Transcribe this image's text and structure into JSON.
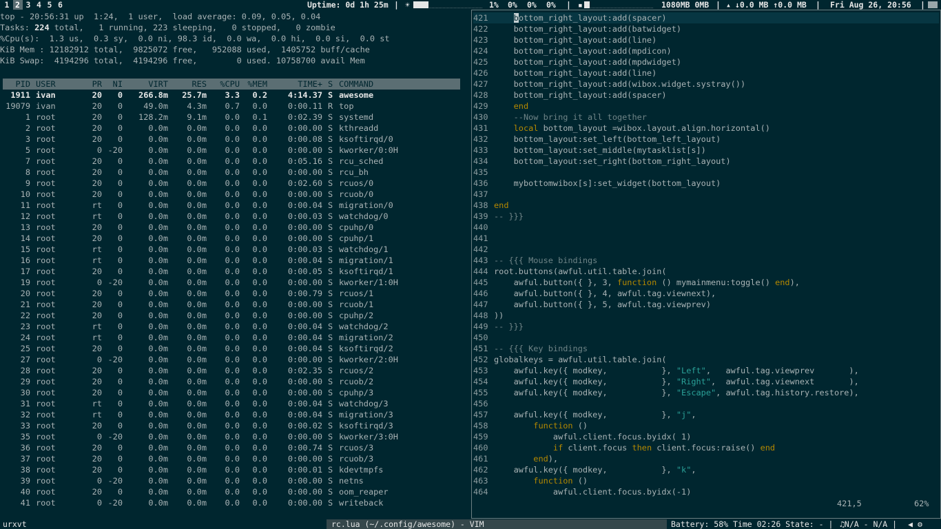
{
  "topbar": {
    "tags": [
      "1",
      "2",
      "3",
      "4",
      "5",
      "6"
    ],
    "selected_tag": "2",
    "uptime": "Uptime: 0d 1h 25m",
    "cpu1": "1%",
    "cpu2": "0%",
    "cpu3": "0%",
    "cpu4": "0%",
    "memory": "1080MB 0MB",
    "net": "↓0.0 MB ↑0.0 MB",
    "date": "Fri Aug 26, 20:56",
    "sep": "|"
  },
  "top": {
    "line1": "top - 20:56:31 up  1:24,  1 user,  load average: 0.09, 0.05, 0.04",
    "tasks_label": "Tasks:",
    "tasks_total": "224",
    "tasks_rest": " total,   1 running, 223 sleeping,   0 stopped,   0 zombie",
    "cpu_line": "%Cpu(s):  1.3 us,  0.3 sy,  0.0 ni, 98.3 id,  0.0 wa,  0.0 hi,  0.0 si,  0.0 st",
    "mem_line": "KiB Mem : 12182912 total,  9825072 free,   952088 used,  1405752 buff/cache",
    "swap_line": "KiB Swap:  4194296 total,  4194296 free,        0 used. 10758700 avail Mem",
    "columns": [
      "PID",
      "USER",
      "PR",
      "NI",
      "VIRT",
      "RES",
      "%CPU",
      "%MEM",
      "TIME+",
      "S",
      "COMMAND"
    ],
    "processes": [
      [
        "1911",
        "ivan",
        "20",
        "0",
        "266.8m",
        "25.7m",
        "3.3",
        "0.2",
        "4:14.37",
        "S",
        "awesome"
      ],
      [
        "19079",
        "ivan",
        "20",
        "0",
        "49.0m",
        "4.3m",
        "0.7",
        "0.0",
        "0:00.11",
        "R",
        "top"
      ],
      [
        "1",
        "root",
        "20",
        "0",
        "128.2m",
        "9.1m",
        "0.0",
        "0.1",
        "0:02.39",
        "S",
        "systemd"
      ],
      [
        "2",
        "root",
        "20",
        "0",
        "0.0m",
        "0.0m",
        "0.0",
        "0.0",
        "0:00.00",
        "S",
        "kthreadd"
      ],
      [
        "3",
        "root",
        "20",
        "0",
        "0.0m",
        "0.0m",
        "0.0",
        "0.0",
        "0:00.08",
        "S",
        "ksoftirqd/0"
      ],
      [
        "5",
        "root",
        "0",
        "-20",
        "0.0m",
        "0.0m",
        "0.0",
        "0.0",
        "0:00.00",
        "S",
        "kworker/0:0H"
      ],
      [
        "7",
        "root",
        "20",
        "0",
        "0.0m",
        "0.0m",
        "0.0",
        "0.0",
        "0:05.16",
        "S",
        "rcu_sched"
      ],
      [
        "8",
        "root",
        "20",
        "0",
        "0.0m",
        "0.0m",
        "0.0",
        "0.0",
        "0:00.00",
        "S",
        "rcu_bh"
      ],
      [
        "9",
        "root",
        "20",
        "0",
        "0.0m",
        "0.0m",
        "0.0",
        "0.0",
        "0:02.60",
        "S",
        "rcuos/0"
      ],
      [
        "10",
        "root",
        "20",
        "0",
        "0.0m",
        "0.0m",
        "0.0",
        "0.0",
        "0:00.00",
        "S",
        "rcuob/0"
      ],
      [
        "11",
        "root",
        "rt",
        "0",
        "0.0m",
        "0.0m",
        "0.0",
        "0.0",
        "0:00.04",
        "S",
        "migration/0"
      ],
      [
        "12",
        "root",
        "rt",
        "0",
        "0.0m",
        "0.0m",
        "0.0",
        "0.0",
        "0:00.03",
        "S",
        "watchdog/0"
      ],
      [
        "13",
        "root",
        "20",
        "0",
        "0.0m",
        "0.0m",
        "0.0",
        "0.0",
        "0:00.00",
        "S",
        "cpuhp/0"
      ],
      [
        "14",
        "root",
        "20",
        "0",
        "0.0m",
        "0.0m",
        "0.0",
        "0.0",
        "0:00.00",
        "S",
        "cpuhp/1"
      ],
      [
        "15",
        "root",
        "rt",
        "0",
        "0.0m",
        "0.0m",
        "0.0",
        "0.0",
        "0:00.03",
        "S",
        "watchdog/1"
      ],
      [
        "16",
        "root",
        "rt",
        "0",
        "0.0m",
        "0.0m",
        "0.0",
        "0.0",
        "0:00.04",
        "S",
        "migration/1"
      ],
      [
        "17",
        "root",
        "20",
        "0",
        "0.0m",
        "0.0m",
        "0.0",
        "0.0",
        "0:00.05",
        "S",
        "ksoftirqd/1"
      ],
      [
        "19",
        "root",
        "0",
        "-20",
        "0.0m",
        "0.0m",
        "0.0",
        "0.0",
        "0:00.00",
        "S",
        "kworker/1:0H"
      ],
      [
        "20",
        "root",
        "20",
        "0",
        "0.0m",
        "0.0m",
        "0.0",
        "0.0",
        "0:00.79",
        "S",
        "rcuos/1"
      ],
      [
        "21",
        "root",
        "20",
        "0",
        "0.0m",
        "0.0m",
        "0.0",
        "0.0",
        "0:00.00",
        "S",
        "rcuob/1"
      ],
      [
        "22",
        "root",
        "20",
        "0",
        "0.0m",
        "0.0m",
        "0.0",
        "0.0",
        "0:00.00",
        "S",
        "cpuhp/2"
      ],
      [
        "23",
        "root",
        "rt",
        "0",
        "0.0m",
        "0.0m",
        "0.0",
        "0.0",
        "0:00.04",
        "S",
        "watchdog/2"
      ],
      [
        "24",
        "root",
        "rt",
        "0",
        "0.0m",
        "0.0m",
        "0.0",
        "0.0",
        "0:00.04",
        "S",
        "migration/2"
      ],
      [
        "25",
        "root",
        "20",
        "0",
        "0.0m",
        "0.0m",
        "0.0",
        "0.0",
        "0:00.04",
        "S",
        "ksoftirqd/2"
      ],
      [
        "27",
        "root",
        "0",
        "-20",
        "0.0m",
        "0.0m",
        "0.0",
        "0.0",
        "0:00.00",
        "S",
        "kworker/2:0H"
      ],
      [
        "28",
        "root",
        "20",
        "0",
        "0.0m",
        "0.0m",
        "0.0",
        "0.0",
        "0:02.35",
        "S",
        "rcuos/2"
      ],
      [
        "29",
        "root",
        "20",
        "0",
        "0.0m",
        "0.0m",
        "0.0",
        "0.0",
        "0:00.00",
        "S",
        "rcuob/2"
      ],
      [
        "30",
        "root",
        "20",
        "0",
        "0.0m",
        "0.0m",
        "0.0",
        "0.0",
        "0:00.00",
        "S",
        "cpuhp/3"
      ],
      [
        "31",
        "root",
        "rt",
        "0",
        "0.0m",
        "0.0m",
        "0.0",
        "0.0",
        "0:00.04",
        "S",
        "watchdog/3"
      ],
      [
        "32",
        "root",
        "rt",
        "0",
        "0.0m",
        "0.0m",
        "0.0",
        "0.0",
        "0:00.04",
        "S",
        "migration/3"
      ],
      [
        "33",
        "root",
        "20",
        "0",
        "0.0m",
        "0.0m",
        "0.0",
        "0.0",
        "0:00.02",
        "S",
        "ksoftirqd/3"
      ],
      [
        "35",
        "root",
        "0",
        "-20",
        "0.0m",
        "0.0m",
        "0.0",
        "0.0",
        "0:00.00",
        "S",
        "kworker/3:0H"
      ],
      [
        "36",
        "root",
        "20",
        "0",
        "0.0m",
        "0.0m",
        "0.0",
        "0.0",
        "0:00.74",
        "S",
        "rcuos/3"
      ],
      [
        "37",
        "root",
        "20",
        "0",
        "0.0m",
        "0.0m",
        "0.0",
        "0.0",
        "0:00.00",
        "S",
        "rcuob/3"
      ],
      [
        "38",
        "root",
        "20",
        "0",
        "0.0m",
        "0.0m",
        "0.0",
        "0.0",
        "0:00.01",
        "S",
        "kdevtmpfs"
      ],
      [
        "39",
        "root",
        "0",
        "-20",
        "0.0m",
        "0.0m",
        "0.0",
        "0.0",
        "0:00.00",
        "S",
        "netns"
      ],
      [
        "40",
        "root",
        "20",
        "0",
        "0.0m",
        "0.0m",
        "0.0",
        "0.0",
        "0:00.00",
        "S",
        "oom_reaper"
      ],
      [
        "41",
        "root",
        "0",
        "-20",
        "0.0m",
        "0.0m",
        "0.0",
        "0.0",
        "0:00.00",
        "S",
        "writeback"
      ]
    ]
  },
  "vim": {
    "lines": [
      {
        "n": "421",
        "t": [
          [
            "p",
            "    "
          ],
          [
            "c",
            "b"
          ],
          [
            "p",
            "ottom_right_layout:add(spacer)"
          ]
        ]
      },
      {
        "n": "422",
        "t": [
          [
            "p",
            "    bottom_right_layout:add(batwidget)"
          ]
        ]
      },
      {
        "n": "423",
        "t": [
          [
            "p",
            "    bottom_right_layout:add(line)"
          ]
        ]
      },
      {
        "n": "424",
        "t": [
          [
            "p",
            "    bottom_right_layout:add(mpdicon)"
          ]
        ]
      },
      {
        "n": "425",
        "t": [
          [
            "p",
            "    bottom_right_layout:add(mpdwidget)"
          ]
        ]
      },
      {
        "n": "426",
        "t": [
          [
            "p",
            "    bottom_right_layout:add(line)"
          ]
        ]
      },
      {
        "n": "427",
        "t": [
          [
            "p",
            "    bottom_right_layout:add(wibox.widget.systray())"
          ]
        ]
      },
      {
        "n": "428",
        "t": [
          [
            "p",
            "    bottom_right_layout:add(spacer)"
          ]
        ]
      },
      {
        "n": "429",
        "t": [
          [
            "p",
            "    "
          ],
          [
            "k",
            "end"
          ]
        ]
      },
      {
        "n": "430",
        "t": [
          [
            "p",
            "    "
          ],
          [
            "m",
            "--Now bring it all together"
          ]
        ]
      },
      {
        "n": "431",
        "t": [
          [
            "p",
            "    "
          ],
          [
            "k",
            "local"
          ],
          [
            "p",
            " bottom_layout =wibox.layout.align.horizontal()"
          ]
        ]
      },
      {
        "n": "432",
        "t": [
          [
            "p",
            "    bottom_layout:set_left(bottom_left_layout)"
          ]
        ]
      },
      {
        "n": "433",
        "t": [
          [
            "p",
            "    bottom_layout:set_middle(mytasklist[s])"
          ]
        ]
      },
      {
        "n": "434",
        "t": [
          [
            "p",
            "    bottom_layout:set_right(bottom_right_layout)"
          ]
        ]
      },
      {
        "n": "435",
        "t": []
      },
      {
        "n": "436",
        "t": [
          [
            "p",
            "    mybottomwibox[s]:set_widget(bottom_layout)"
          ]
        ]
      },
      {
        "n": "437",
        "t": []
      },
      {
        "n": "438",
        "t": [
          [
            "k",
            "end"
          ]
        ]
      },
      {
        "n": "439",
        "t": [
          [
            "m",
            "-- }}}"
          ]
        ]
      },
      {
        "n": "440",
        "t": []
      },
      {
        "n": "441",
        "t": []
      },
      {
        "n": "442",
        "t": []
      },
      {
        "n": "443",
        "t": [
          [
            "m",
            "-- {{{ Mouse bindings"
          ]
        ]
      },
      {
        "n": "444",
        "t": [
          [
            "p",
            "root.buttons(awful.util.table.join("
          ]
        ]
      },
      {
        "n": "445",
        "t": [
          [
            "p",
            "    awful.button({ }, 3, "
          ],
          [
            "k",
            "function"
          ],
          [
            "p",
            " () mymainmenu:toggle() "
          ],
          [
            "k",
            "end"
          ],
          [
            "p",
            "),"
          ]
        ]
      },
      {
        "n": "446",
        "t": [
          [
            "p",
            "    awful.button({ }, 4, awful.tag.viewnext),"
          ]
        ]
      },
      {
        "n": "447",
        "t": [
          [
            "p",
            "    awful.button({ }, 5, awful.tag.viewprev)"
          ]
        ]
      },
      {
        "n": "448",
        "t": [
          [
            "p",
            "))"
          ]
        ]
      },
      {
        "n": "449",
        "t": [
          [
            "m",
            "-- }}}"
          ]
        ]
      },
      {
        "n": "450",
        "t": []
      },
      {
        "n": "451",
        "t": [
          [
            "m",
            "-- {{{ Key bindings"
          ]
        ]
      },
      {
        "n": "452",
        "t": [
          [
            "p",
            "globalkeys = awful.util.table.join("
          ]
        ]
      },
      {
        "n": "453",
        "t": [
          [
            "p",
            "    awful.key({ modkey,           }, "
          ],
          [
            "s",
            "\"Left\""
          ],
          [
            "p",
            ",   awful.tag.viewprev       ),"
          ]
        ]
      },
      {
        "n": "454",
        "t": [
          [
            "p",
            "    awful.key({ modkey,           }, "
          ],
          [
            "s",
            "\"Right\""
          ],
          [
            "p",
            ",  awful.tag.viewnext       ),"
          ]
        ]
      },
      {
        "n": "455",
        "t": [
          [
            "p",
            "    awful.key({ modkey,           }, "
          ],
          [
            "s",
            "\"Escape\""
          ],
          [
            "p",
            ", awful.tag.history.restore),"
          ]
        ]
      },
      {
        "n": "456",
        "t": []
      },
      {
        "n": "457",
        "t": [
          [
            "p",
            "    awful.key({ modkey,           }, "
          ],
          [
            "s",
            "\"j\""
          ],
          [
            "p",
            ","
          ]
        ]
      },
      {
        "n": "458",
        "t": [
          [
            "p",
            "        "
          ],
          [
            "k",
            "function"
          ],
          [
            "p",
            " ()"
          ]
        ]
      },
      {
        "n": "459",
        "t": [
          [
            "p",
            "            awful.client.focus.byidx( 1)"
          ]
        ]
      },
      {
        "n": "460",
        "t": [
          [
            "p",
            "            "
          ],
          [
            "k",
            "if"
          ],
          [
            "p",
            " client.focus "
          ],
          [
            "k",
            "then"
          ],
          [
            "p",
            " client.focus:raise() "
          ],
          [
            "k",
            "end"
          ]
        ]
      },
      {
        "n": "461",
        "t": [
          [
            "p",
            "        "
          ],
          [
            "k",
            "end"
          ],
          [
            "p",
            "),"
          ]
        ]
      },
      {
        "n": "462",
        "t": [
          [
            "p",
            "    awful.key({ modkey,           }, "
          ],
          [
            "s",
            "\"k\""
          ],
          [
            "p",
            ","
          ]
        ]
      },
      {
        "n": "463",
        "t": [
          [
            "p",
            "        "
          ],
          [
            "k",
            "function"
          ],
          [
            "p",
            " ()"
          ]
        ]
      },
      {
        "n": "464",
        "t": [
          [
            "p",
            "            awful.client.focus.byidx(-1)"
          ]
        ]
      }
    ],
    "position": "421,5",
    "percent": "62%"
  },
  "bottombar": {
    "task1": "urxvt",
    "task2": "rc.lua (~/.config/awesome) - VIM",
    "battery": "Battery: 58% Time 02:26 State: - |",
    "mpd": "♫N/A - N/A |"
  },
  "colors": {
    "background": "#00262f",
    "accent": "#5b6e73",
    "keyword": "#b58900",
    "string": "#2aa198"
  },
  "levels": {
    "brightness": 0.22,
    "volume": 0.08
  }
}
